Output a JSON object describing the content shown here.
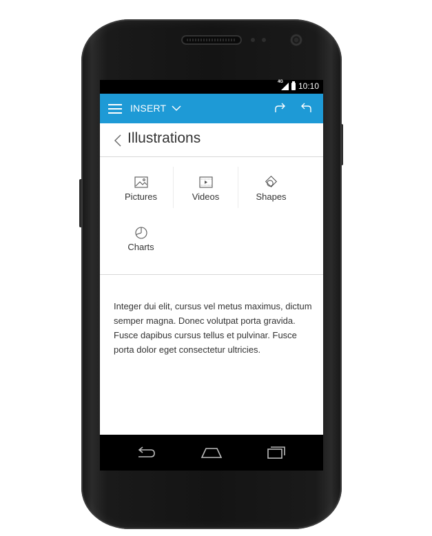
{
  "status_bar": {
    "network": "4G",
    "time": "10:10"
  },
  "app_bar": {
    "menu_icon": "hamburger-menu-icon",
    "title": "INSERT",
    "dropdown_icon": "chevron-down-icon",
    "redo_icon": "redo-icon",
    "undo_icon": "undo-icon",
    "color": "#1e9ad6"
  },
  "section": {
    "back_icon": "chevron-left-icon",
    "title": "Illustrations"
  },
  "items": [
    {
      "label": "Pictures",
      "icon": "picture-icon"
    },
    {
      "label": "Videos",
      "icon": "video-icon"
    },
    {
      "label": "Shapes",
      "icon": "shapes-icon"
    },
    {
      "label": "Charts",
      "icon": "chart-icon"
    }
  ],
  "body": {
    "text": "Integer dui elit, cursus vel metus maximus, dictum semper magna. Donec volutpat porta gravida. Fusce dapibus cursus tellus et pulvinar. Fusce porta dolor eget consectetur ultricies."
  },
  "nav_bar": {
    "back_icon": "nav-back-icon",
    "home_icon": "nav-home-icon",
    "recents_icon": "nav-recents-icon"
  }
}
